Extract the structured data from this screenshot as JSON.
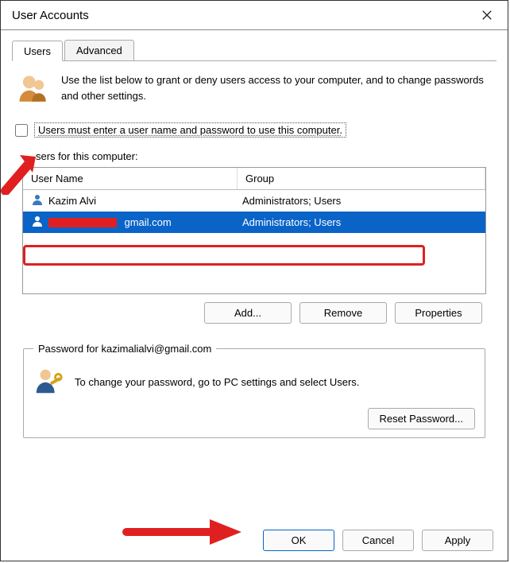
{
  "window": {
    "title": "User Accounts"
  },
  "tabs": [
    {
      "label": "Users",
      "active": true
    },
    {
      "label": "Advanced",
      "active": false
    }
  ],
  "intro_text": "Use the list below to grant or deny users access to your computer, and to change passwords and other settings.",
  "checkbox_label": "Users must enter a user name and password to use this computer.",
  "users_section_label": "sers for this computer:",
  "table": {
    "columns": [
      "User Name",
      "Group"
    ],
    "rows": [
      {
        "username": "Kazim Alvi",
        "group": "Administrators; Users",
        "selected": false
      },
      {
        "username_suffix": "gmail.com",
        "group": "Administrators; Users",
        "selected": true,
        "redacted": true
      }
    ]
  },
  "user_buttons": {
    "add": "Add...",
    "remove": "Remove",
    "properties": "Properties"
  },
  "password_group": {
    "legend": "Password for kazimalialvi@gmail.com",
    "text": "To change your password, go to PC settings and select Users.",
    "reset": "Reset Password..."
  },
  "footer": {
    "ok": "OK",
    "cancel": "Cancel",
    "apply": "Apply"
  }
}
